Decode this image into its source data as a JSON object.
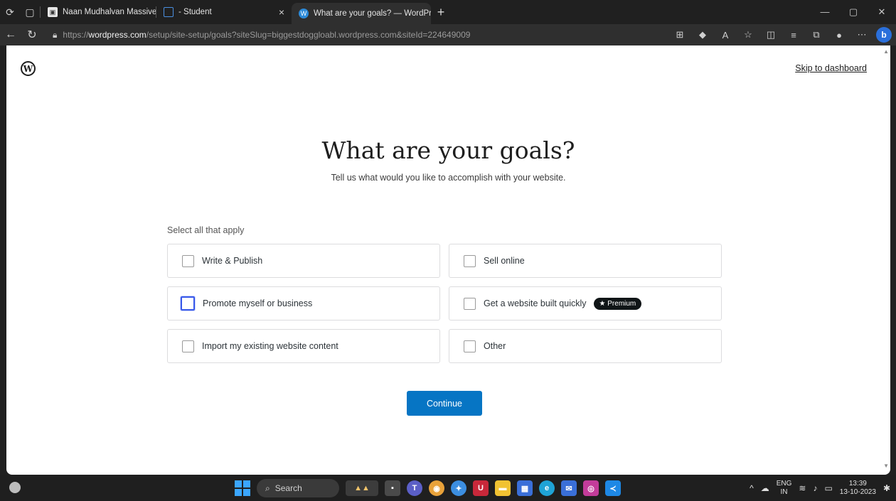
{
  "browser": {
    "tabs": [
      {
        "title": "Naan Mudhalvan Massive Upskil",
        "active": false
      },
      {
        "title": "- Student",
        "active": false
      },
      {
        "title": "What are your goals? — WordPr",
        "active": true
      }
    ],
    "url": {
      "prefix": "https://",
      "host": "wordpress.com",
      "path": "/setup/site-setup/goals?siteSlug=biggestdoggloabl.wordpress.com&siteId=224649009"
    },
    "bing_label": "b"
  },
  "page": {
    "skip_link": "Skip to dashboard",
    "heading": "What are your goals?",
    "subheading": "Tell us what would you like to accomplish with your website.",
    "select_label": "Select all that apply",
    "options": [
      {
        "label": "Write & Publish",
        "checked": false
      },
      {
        "label": "Sell online",
        "checked": false
      },
      {
        "label": "Promote myself or business",
        "checked": false,
        "focused": true
      },
      {
        "label": "Get a website built quickly",
        "checked": false,
        "badge": "★ Premium"
      },
      {
        "label": "Import my existing website content",
        "checked": false
      },
      {
        "label": "Other",
        "checked": false
      }
    ],
    "continue_label": "Continue"
  },
  "taskbar": {
    "search_label": "Search",
    "language": "ENG",
    "region": "IN",
    "time": "13:39",
    "date": "13-10-2023"
  },
  "colors": {
    "primary_button": "#0675c4",
    "focus_ring": "#3858e9",
    "badge_bg": "#101517"
  }
}
